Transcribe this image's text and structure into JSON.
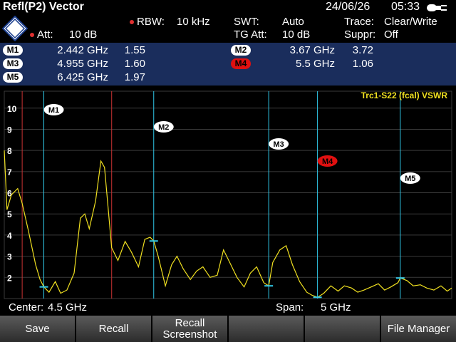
{
  "title_bar": {
    "mode": "Refl(P2) Vector",
    "date": "24/06/26",
    "time": "05:33"
  },
  "settings": {
    "rbw_label": "RBW:",
    "rbw_value": "10 kHz",
    "att_label": "Att:",
    "att_value": "10 dB",
    "swt_label": "SWT:",
    "swt_value": "Auto",
    "tgatt_label": "TG Att:",
    "tgatt_value": "10 dB",
    "trace_label": "Trace:",
    "trace_value": "Clear/Write",
    "suppr_label": "Suppr:",
    "suppr_value": "Off"
  },
  "markers": [
    {
      "name": "M1",
      "freq": "2.442 GHz",
      "value": "1.55",
      "active": false
    },
    {
      "name": "M2",
      "freq": "3.67 GHz",
      "value": "3.72",
      "active": false
    },
    {
      "name": "M3",
      "freq": "4.955 GHz",
      "value": "1.60",
      "active": false
    },
    {
      "name": "M4",
      "freq": "5.5 GHz",
      "value": "1.06",
      "active": true
    },
    {
      "name": "M5",
      "freq": "6.425 GHz",
      "value": "1.97",
      "active": false
    }
  ],
  "plot": {
    "trace_label": "Trc1-S22 (fcal) VSWR",
    "trace_color": "#f0e020",
    "label_color": "#30c8e8",
    "center_label": "Center:",
    "center_value": "4.5 GHz",
    "span_label": "Span:",
    "span_value": "5 GHz",
    "y_ticks": [
      "10",
      "9",
      "8",
      "7",
      "6",
      "5",
      "4",
      "3",
      "2"
    ]
  },
  "chart_data": {
    "type": "line",
    "x_range_ghz": [
      2.0,
      7.0
    ],
    "ylim": [
      1,
      10.8
    ],
    "series": [
      {
        "name": "Trc1-S22",
        "x": [
          2.0,
          2.03,
          2.08,
          2.15,
          2.2,
          2.27,
          2.35,
          2.4,
          2.442,
          2.5,
          2.57,
          2.63,
          2.7,
          2.78,
          2.85,
          2.9,
          2.95,
          3.02,
          3.08,
          3.12,
          3.16,
          3.2,
          3.27,
          3.35,
          3.42,
          3.5,
          3.57,
          3.63,
          3.67,
          3.72,
          3.8,
          3.87,
          3.93,
          4.0,
          4.08,
          4.15,
          4.22,
          4.3,
          4.38,
          4.45,
          4.52,
          4.6,
          4.68,
          4.75,
          4.82,
          4.9,
          4.955,
          5.0,
          5.08,
          5.15,
          5.22,
          5.3,
          5.38,
          5.44,
          5.5,
          5.57,
          5.65,
          5.73,
          5.8,
          5.88,
          5.95,
          6.02,
          6.1,
          6.18,
          6.25,
          6.32,
          6.4,
          6.425,
          6.5,
          6.57,
          6.65,
          6.72,
          6.8,
          6.88,
          6.95,
          7.0
        ],
        "values": [
          8.0,
          5.2,
          5.9,
          6.2,
          5.5,
          4.2,
          2.6,
          1.9,
          1.55,
          1.3,
          1.8,
          1.25,
          1.4,
          2.2,
          4.8,
          5.0,
          4.3,
          5.6,
          7.5,
          7.2,
          5.3,
          3.4,
          2.8,
          3.7,
          3.2,
          2.5,
          3.8,
          3.9,
          3.72,
          3.0,
          1.6,
          2.6,
          3.0,
          2.4,
          1.9,
          2.3,
          2.5,
          2.0,
          2.1,
          3.3,
          2.7,
          2.0,
          1.55,
          2.2,
          2.5,
          1.75,
          1.6,
          2.7,
          3.3,
          3.5,
          2.6,
          1.8,
          1.3,
          1.15,
          1.06,
          1.25,
          1.6,
          1.35,
          1.6,
          1.5,
          1.3,
          1.4,
          1.55,
          1.7,
          1.4,
          1.55,
          1.75,
          1.97,
          1.85,
          1.6,
          1.65,
          1.5,
          1.4,
          1.6,
          1.35,
          1.5
        ]
      }
    ],
    "markers_ghz": [
      2.442,
      3.67,
      4.955,
      5.5,
      6.425
    ],
    "grid": true
  },
  "softkeys": [
    {
      "label": "Save"
    },
    {
      "label": "Recall"
    },
    {
      "label": "Recall Screenshot"
    },
    {
      "label": ""
    },
    {
      "label": ""
    },
    {
      "label": "File Manager"
    }
  ]
}
